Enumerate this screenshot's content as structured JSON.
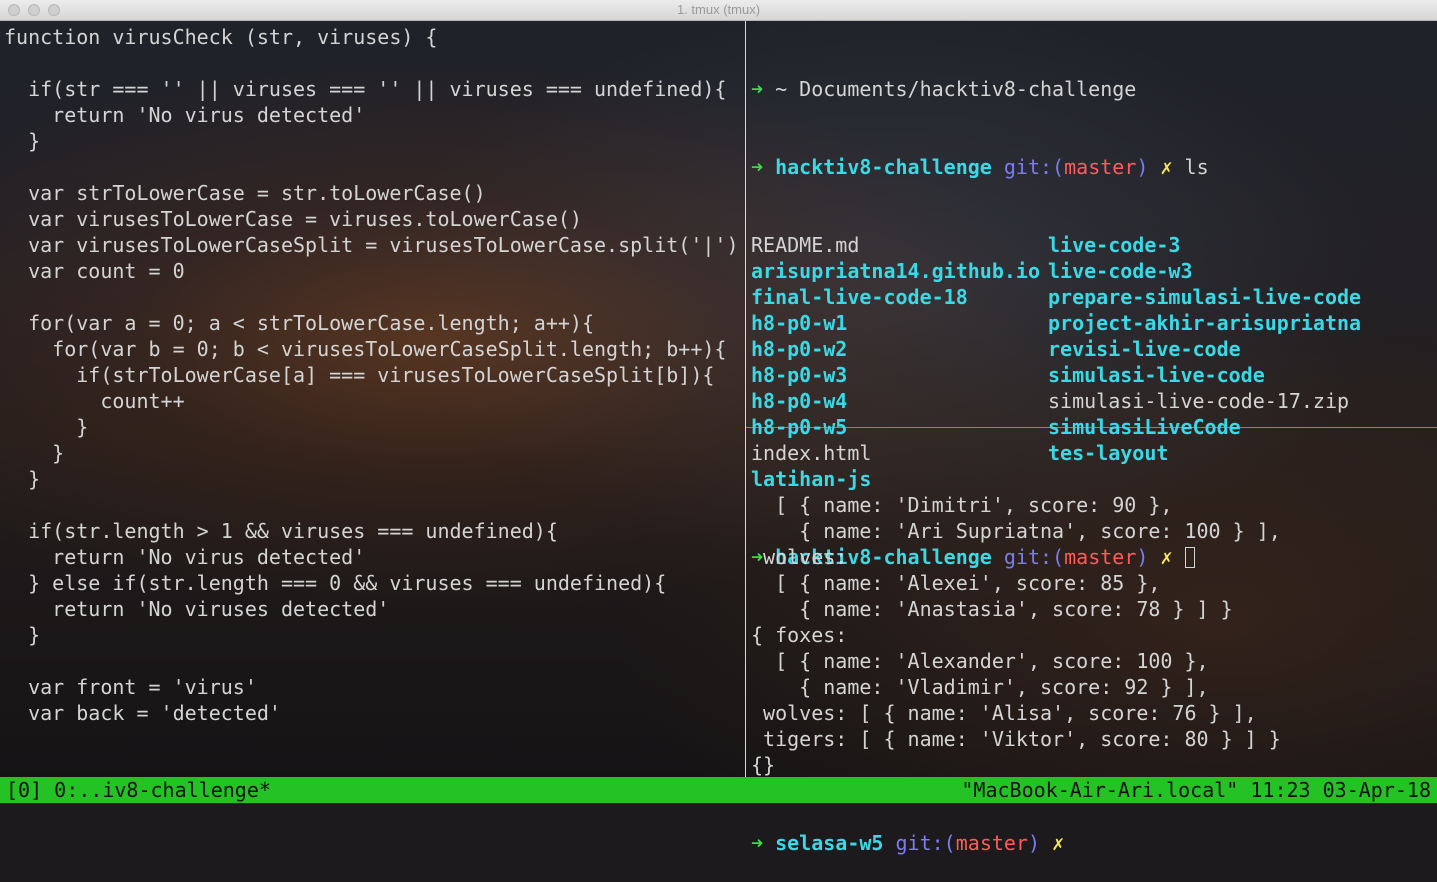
{
  "window": {
    "title": "1. tmux (tmux)"
  },
  "left_pane": {
    "lines": [
      "function virusCheck (str, viruses) {",
      "",
      "  if(str === '' || viruses === '' || viruses === undefined){",
      "    return 'No virus detected'",
      "  }",
      "",
      "  var strToLowerCase = str.toLowerCase()",
      "  var virusesToLowerCase = viruses.toLowerCase()",
      "  var virusesToLowerCaseSplit = virusesToLowerCase.split('|')",
      "  var count = 0",
      "",
      "  for(var a = 0; a < strToLowerCase.length; a++){",
      "    for(var b = 0; b < virusesToLowerCaseSplit.length; b++){",
      "      if(strToLowerCase[a] === virusesToLowerCaseSplit[b]){",
      "        count++",
      "      }",
      "    }",
      "  }",
      "",
      "  if(str.length > 1 && viruses === undefined){",
      "    return 'No virus detected'",
      "  } else if(str.length === 0 && viruses === undefined){",
      "    return 'No viruses detected'",
      "  }",
      "",
      "  var front = 'virus'",
      "  var back = 'detected'"
    ]
  },
  "top_right_pane": {
    "first_line": {
      "arrow": "➜",
      "text": " ~ Documents/hacktiv8-challenge"
    },
    "prompt": {
      "arrow": "➜",
      "dir": "hacktiv8-challenge",
      "git": "git:(",
      "branch": "master",
      "git_close": ")",
      "x": "✗",
      "cmd": "ls"
    },
    "ls_entries": [
      {
        "name": "README.md",
        "type": "file"
      },
      {
        "name": "live-code-3",
        "type": "dir"
      },
      {
        "name": "arisupriatna14.github.io",
        "type": "dir"
      },
      {
        "name": "live-code-w3",
        "type": "dir"
      },
      {
        "name": "final-live-code-18",
        "type": "dir"
      },
      {
        "name": "prepare-simulasi-live-code",
        "type": "dir"
      },
      {
        "name": "h8-p0-w1",
        "type": "dir"
      },
      {
        "name": "project-akhir-arisupriatna",
        "type": "dir"
      },
      {
        "name": "h8-p0-w2",
        "type": "dir"
      },
      {
        "name": "revisi-live-code",
        "type": "dir"
      },
      {
        "name": "h8-p0-w3",
        "type": "dir"
      },
      {
        "name": "simulasi-live-code",
        "type": "dir"
      },
      {
        "name": "h8-p0-w4",
        "type": "dir"
      },
      {
        "name": "simulasi-live-code-17.zip",
        "type": "file"
      },
      {
        "name": "h8-p0-w5",
        "type": "dir"
      },
      {
        "name": "simulasiLiveCode",
        "type": "dir"
      },
      {
        "name": "index.html",
        "type": "file"
      },
      {
        "name": "tes-layout",
        "type": "dir"
      },
      {
        "name": "latihan-js",
        "type": "dir"
      }
    ],
    "prompt2": {
      "arrow": "➜",
      "dir": "hacktiv8-challenge",
      "git": "git:(",
      "branch": "master",
      "git_close": ")",
      "x": "✗"
    }
  },
  "bottom_right_pane": {
    "lines": [
      "  [ { name: 'Dimitri', score: 90 },",
      "    { name: 'Ari Supriatna', score: 100 } ],",
      " wolves:",
      "  [ { name: 'Alexei', score: 85 },",
      "    { name: 'Anastasia', score: 78 } ] }",
      "{ foxes:",
      "  [ { name: 'Alexander', score: 100 },",
      "    { name: 'Vladimir', score: 92 } ],",
      " wolves: [ { name: 'Alisa', score: 76 } ],",
      " tigers: [ { name: 'Viktor', score: 80 } ] }",
      "{}"
    ],
    "prompt": {
      "arrow": "➜",
      "dir": "selasa-w5",
      "git": "git:(",
      "branch": "master",
      "git_close": ")",
      "x": "✗"
    }
  },
  "status_bar": {
    "left": "[0] 0:..iv8-challenge*",
    "right": "\"MacBook-Air-Ari.local\" 11:23 03-Apr-18"
  },
  "colors": {
    "status_bg": "#25c225",
    "arrow": "#3ddc49",
    "dir": "#3bd8e6",
    "branch": "#ff5b5b",
    "git": "#7b7bf2",
    "x": "#f6e75a",
    "pane_border": "#2fbf33"
  }
}
